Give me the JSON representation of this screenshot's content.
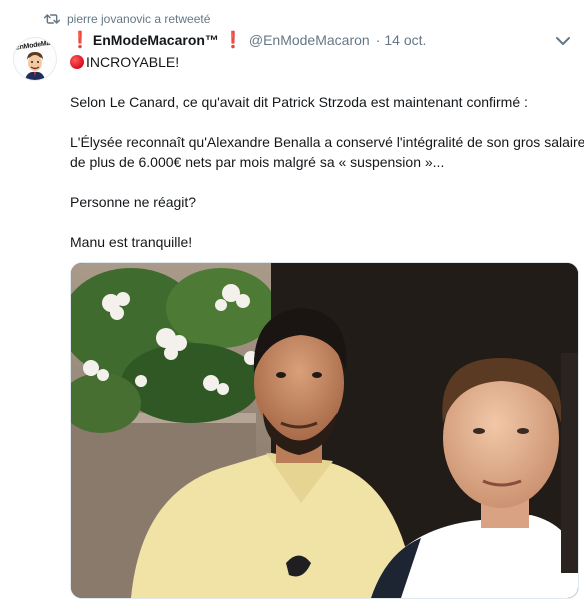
{
  "retweet_context": {
    "icon": "retweet-icon",
    "text": "pierre jovanovic a retweeté"
  },
  "author": {
    "avatar_text": "EnModeMacaron",
    "display_name": "EnModeMacaron™",
    "handle": "@EnModeMacaron",
    "separator": "·",
    "time": "14 oct."
  },
  "tweet": {
    "line1": "INCROYABLE!",
    "line2": "Selon Le Canard, ce qu'avait dit Patrick Strzoda est maintenant confirmé :",
    "line3": "L'Élysée reconnaît qu'Alexandre Benalla a conservé l'intégralité de son gros salaire",
    "line4": "de plus de 6.000€ nets par mois malgré sa « suspension »...",
    "line5": "Personne ne réagit?",
    "line6": "Manu est tranquille!"
  },
  "colors": {
    "accent_red": "#e0142b",
    "meta_gray": "#657786",
    "text": "#14171a"
  }
}
